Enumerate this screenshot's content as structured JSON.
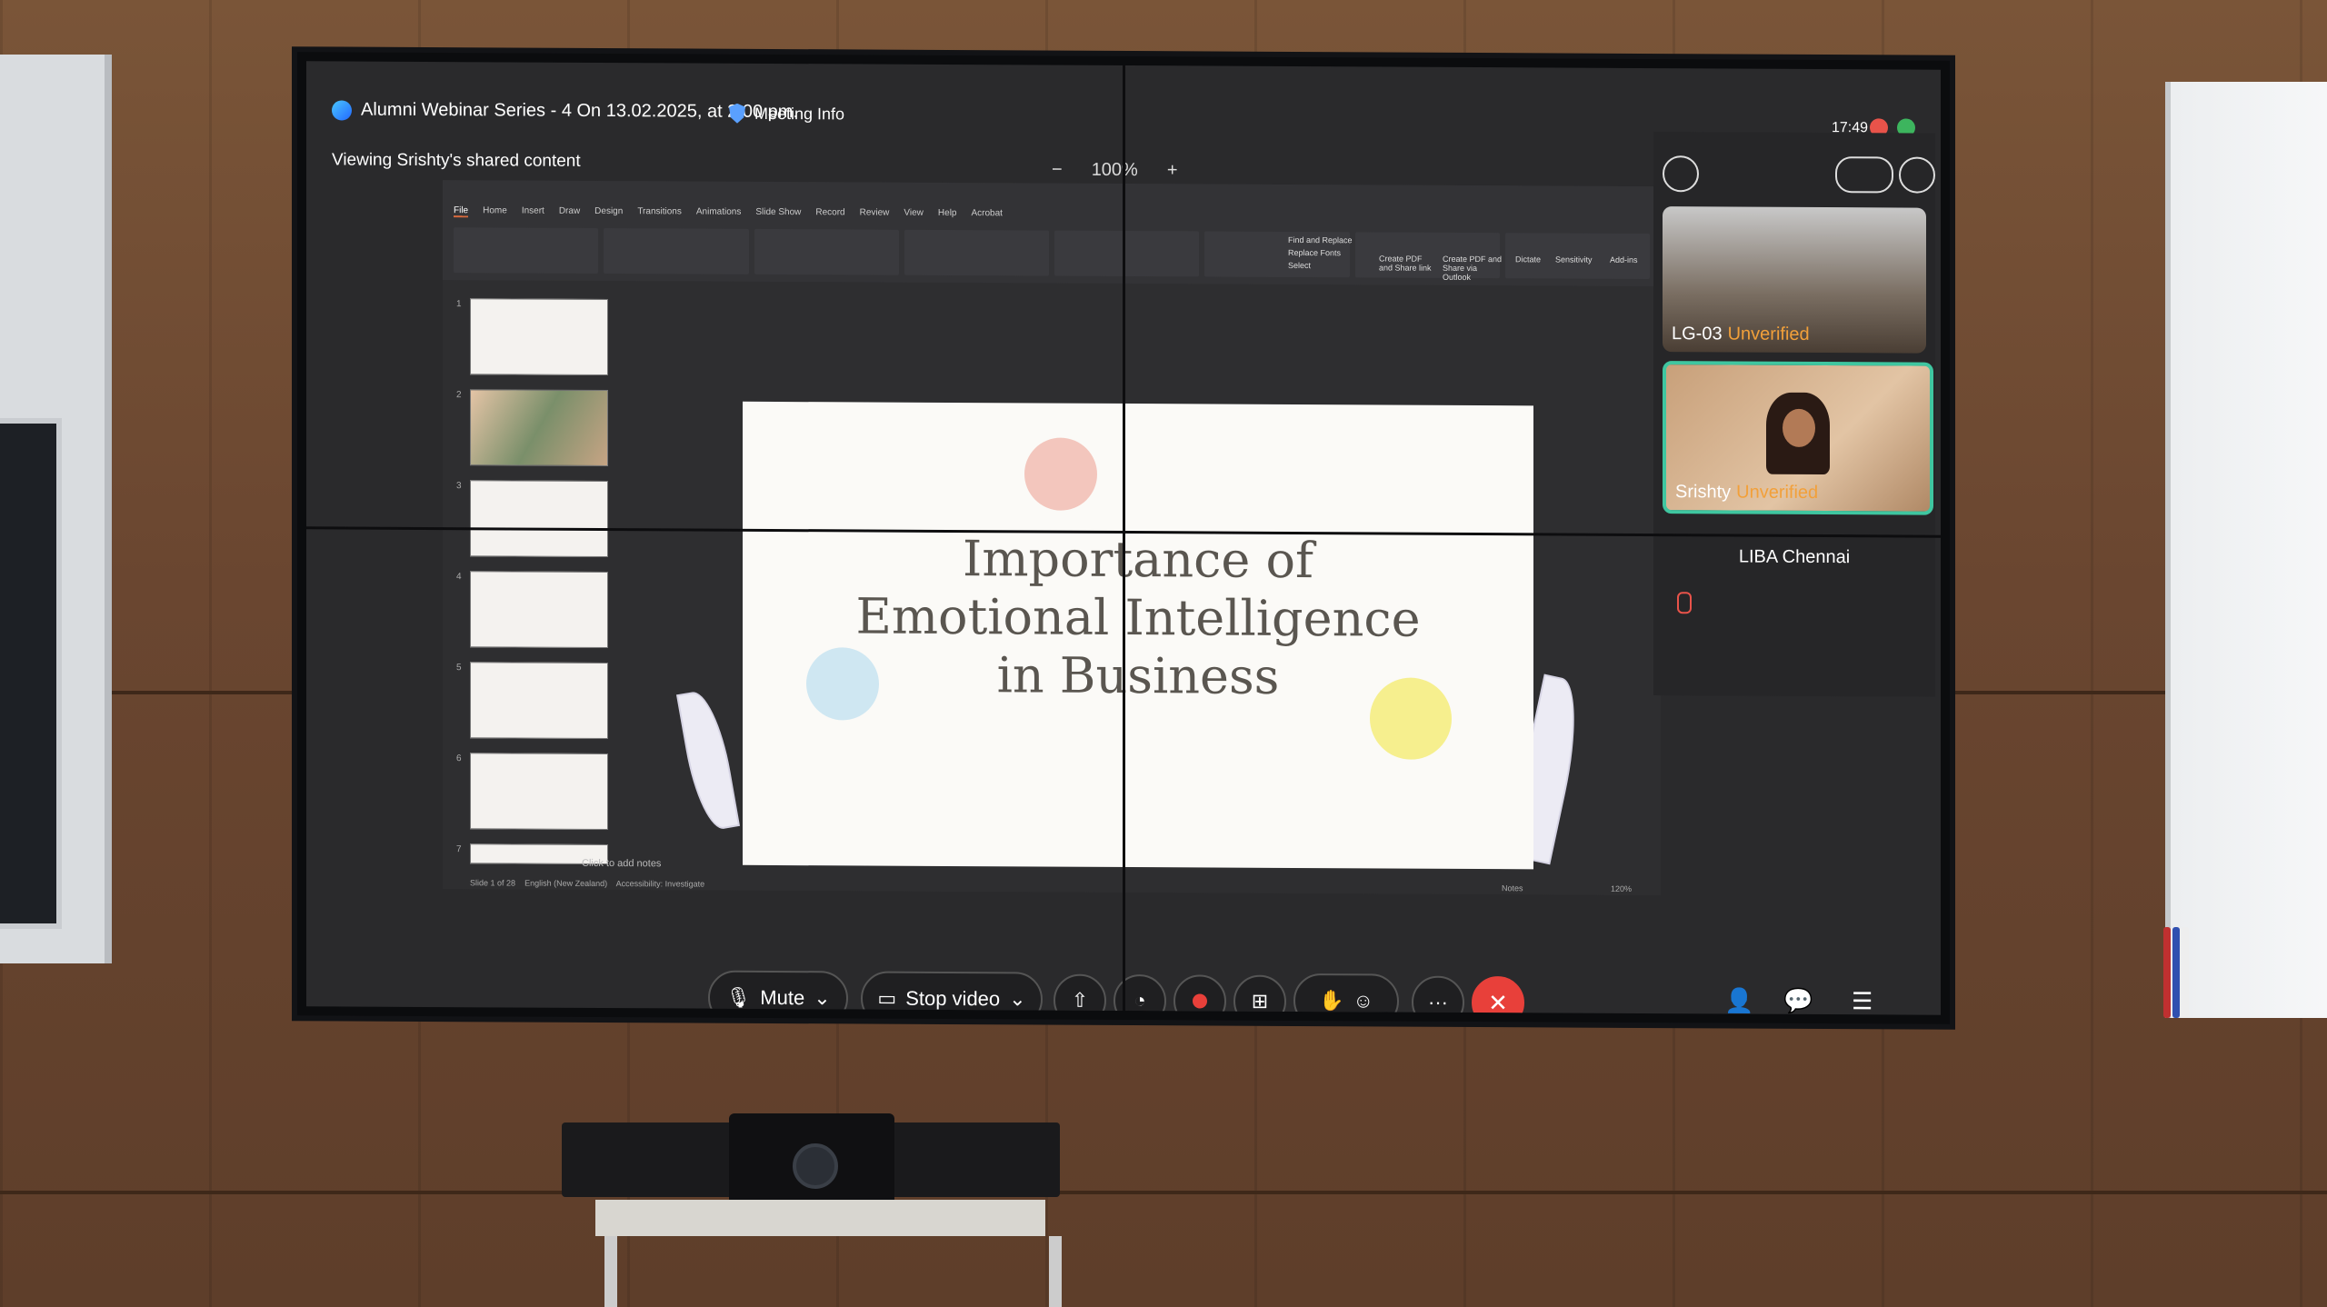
{
  "meeting": {
    "title": "Alumni Webinar Series - 4 On 13.02.2025, at 2.00 pm.",
    "info_label": "Meeting Info",
    "time": "17:49",
    "viewing": "Viewing Srishty's shared content",
    "zoom_minus": "−",
    "zoom_level": "100%",
    "zoom_plus": "+"
  },
  "ppt": {
    "tabs": [
      "File",
      "Home",
      "Insert",
      "Draw",
      "Design",
      "Transitions",
      "Animations",
      "Slide Show",
      "Record",
      "Review",
      "View",
      "Help",
      "Acrobat"
    ],
    "ribbon": {
      "find_replace": "Find and Replace",
      "replace_fonts": "Replace Fonts",
      "select": "Select",
      "create_pdf": "Create PDF and Share link",
      "share_outlook": "Create PDF and Share via Outlook",
      "dictate": "Dictate",
      "sensitivity": "Sensitivity",
      "addins": "Add-ins"
    },
    "thumbnail_numbers": [
      "1",
      "2",
      "3",
      "4",
      "5",
      "6",
      "7"
    ],
    "slide_title_lines": [
      "Importance of",
      "Emotional Intelligence",
      "in Business"
    ],
    "notes_placeholder": "Click to add notes",
    "status_slide": "Slide 1 of 28",
    "status_lang": "English (New Zealand)",
    "status_accessibility": "Accessibility: Investigate",
    "status_notes": "Notes",
    "status_zoom": "120%"
  },
  "participants": {
    "room": {
      "name": "LG-03",
      "status": "Unverified"
    },
    "presenter": {
      "name": "Srishty",
      "status": "Unverified"
    },
    "other": {
      "name": "LIBA Chennai"
    }
  },
  "controls": {
    "mute": "Mute",
    "stop_video": "Stop video",
    "more": "···",
    "end": "✕"
  },
  "colors": {
    "end_call": "#e8403a",
    "active_tile_border": "#3fc6a0",
    "unverified": "#f2a03a"
  }
}
